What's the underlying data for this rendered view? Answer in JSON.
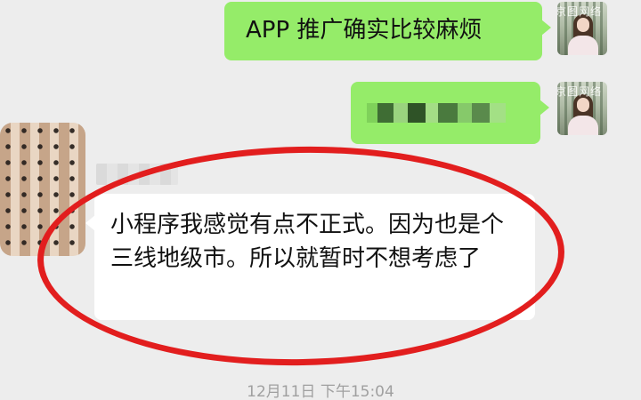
{
  "messages": [
    {
      "sender": "me",
      "text": "APP 推广确实比较麻烦"
    },
    {
      "sender": "me",
      "text": ""
    },
    {
      "sender": "other",
      "text": "小程序我感觉有点不正式。因为也是个三线地级市。所以就暂时不想考虑了"
    }
  ],
  "avatar_watermark": "京图网络",
  "timestamp": "12月11日 下午15:04",
  "colors": {
    "chat_bg": "#ededed",
    "my_bubble": "#95ec69",
    "other_bubble": "#ffffff",
    "highlight_ring": "#e21e1e"
  }
}
